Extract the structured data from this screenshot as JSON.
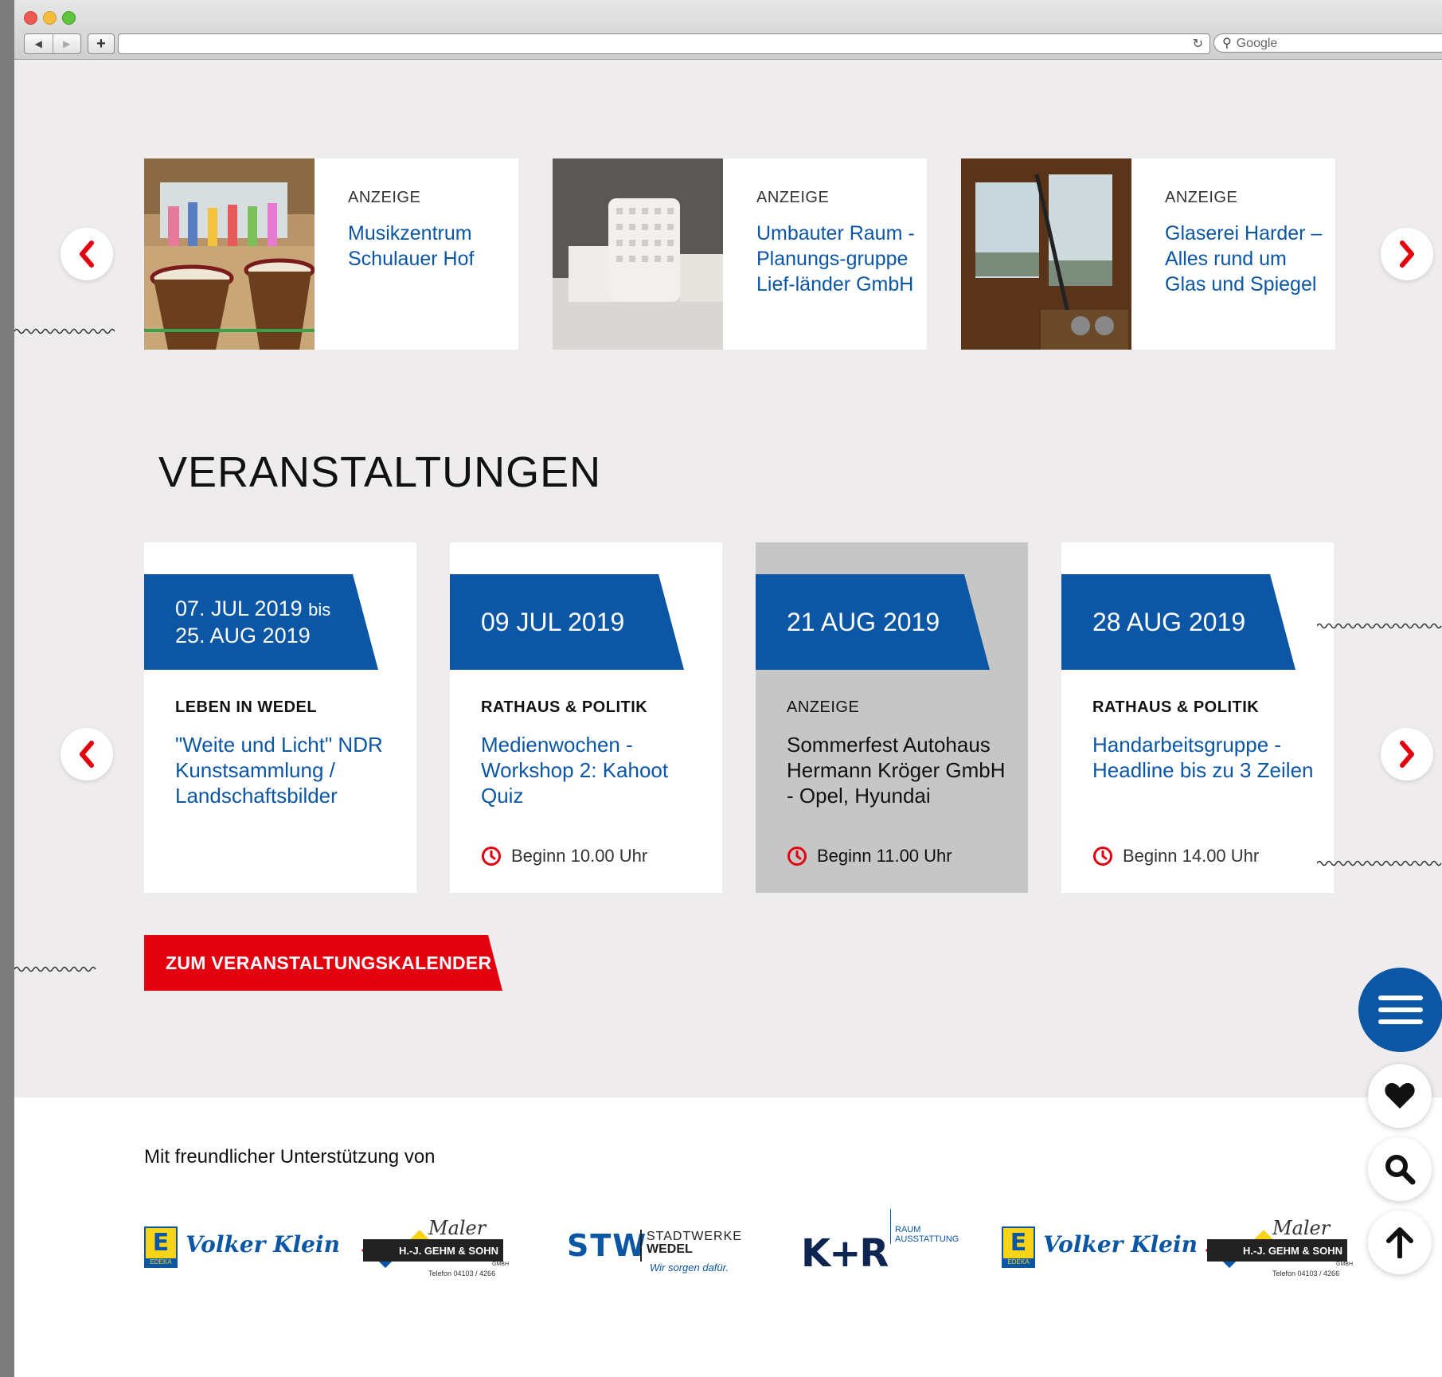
{
  "browser": {
    "search_placeholder": "Google"
  },
  "ads": [
    {
      "label": "ANZEIGE",
      "title": "Musikzentrum Schulauer Hof"
    },
    {
      "label": "ANZEIGE",
      "title": "Umbauter Raum - Planungs-gruppe Lief-länder GmbH"
    },
    {
      "label": "ANZEIGE",
      "title": "Glaserei Harder – Alles rund um Glas und Spiegel"
    }
  ],
  "events_section": {
    "title": "VERANSTALTUNGEN",
    "calendar_button": "ZUM VERANSTALTUNGSKALENDER"
  },
  "events": [
    {
      "date_start": "07. JUL 2019",
      "date_bis": "bis",
      "date_end": "25. AUG 2019",
      "category": "LEBEN IN WEDEL",
      "title": "\"Weite und Licht\" NDR Kunstsammlung / Landschaftsbilder",
      "time": ""
    },
    {
      "date": "09 JUL 2019",
      "category": "RATHAUS & POLITIK",
      "title": "Medienwochen - Workshop 2: Kahoot Quiz",
      "time": "Beginn 10.00 Uhr"
    },
    {
      "date": "21 AUG 2019",
      "category": "ANZEIGE",
      "title": "Sommerfest Autohaus Hermann Kröger GmbH - Opel, Hyundai",
      "time": "Beginn 11.00 Uhr"
    },
    {
      "date": "28 AUG 2019",
      "category": "RATHAUS & POLITIK",
      "title": "Handarbeitsgruppe - Headline bis zu 3 Zeilen",
      "time": "Beginn 14.00 Uhr"
    }
  ],
  "footer": {
    "support_text": "Mit freundlicher Unterstützung von",
    "sponsors": [
      {
        "badge": "E",
        "sub": "EDEKA",
        "name": "Volker Klein"
      },
      {
        "script": "Maler",
        "name": "H.-J. GEHM & SOHN",
        "sub": "GMBH",
        "phone": "Telefon 04103 / 4266"
      },
      {
        "mark": "STW",
        "name_top": "STADTWERKE",
        "name_bottom": "WEDEL",
        "slogan": "Wir sorgen dafür."
      },
      {
        "mark": "K+R",
        "name_top": "RAUM",
        "name_bottom": "AUSSTATTUNG"
      },
      {
        "badge": "E",
        "sub": "EDEKA",
        "name": "Volker Klein"
      },
      {
        "script": "Maler",
        "name": "H.-J. GEHM & SOHN",
        "sub": "GMBH",
        "phone": "Telefon 04103 / 4266"
      }
    ]
  },
  "colors": {
    "brand_blue": "#0b56a5",
    "accent_red": "#e3000f",
    "page_bg": "#efeced"
  },
  "icons": {
    "prev": "chevron-left-icon",
    "next": "chevron-right-icon",
    "menu": "hamburger-menu-icon",
    "favorite": "heart-icon",
    "search": "search-icon",
    "top": "arrow-up-icon",
    "time": "clock-icon"
  }
}
